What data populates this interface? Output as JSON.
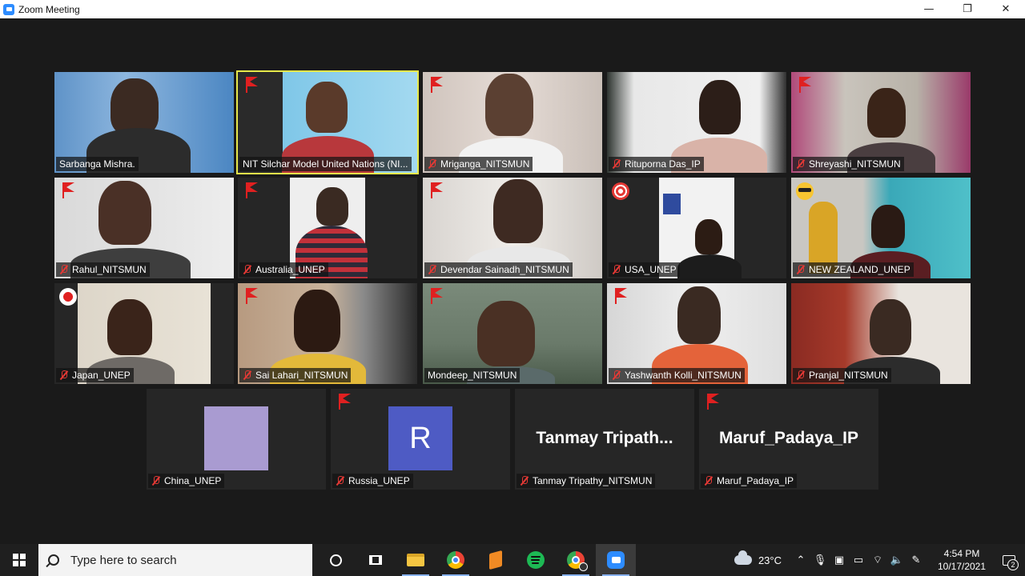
{
  "window": {
    "title": "Zoom Meeting",
    "controls": {
      "minimize": "—",
      "restore": "❐",
      "close": "✕"
    }
  },
  "participants": [
    {
      "name": "Sarbanga Mishra.",
      "muted": false,
      "flag": false,
      "emoji": ""
    },
    {
      "name": "NIT Silchar Model United Nations (NI...",
      "muted": false,
      "flag": true,
      "emoji": ""
    },
    {
      "name": "Mriganga_NITSMUN",
      "muted": true,
      "flag": true,
      "emoji": ""
    },
    {
      "name": "Rituporna Das_IP",
      "muted": true,
      "flag": false,
      "emoji": ""
    },
    {
      "name": "Shreyashi_NITSMUN",
      "muted": true,
      "flag": true,
      "emoji": ""
    },
    {
      "name": "Rahul_NITSMUN",
      "muted": true,
      "flag": true,
      "emoji": ""
    },
    {
      "name": "Australia_UNEP",
      "muted": true,
      "flag": true,
      "emoji": ""
    },
    {
      "name": "Devendar Sainadh_NITSMUN",
      "muted": true,
      "flag": true,
      "emoji": ""
    },
    {
      "name": "USA_UNEP",
      "muted": true,
      "flag": false,
      "emoji": "target"
    },
    {
      "name": "NEW ZEALAND_UNEP",
      "muted": true,
      "flag": false,
      "emoji": "sunglasses"
    },
    {
      "name": "Japan_UNEP",
      "muted": true,
      "flag": false,
      "emoji": "japan-flag"
    },
    {
      "name": "Sai Lahari_NITSMUN",
      "muted": true,
      "flag": true,
      "emoji": ""
    },
    {
      "name": "Mondeep_NITSMUN",
      "muted": false,
      "flag": true,
      "emoji": ""
    },
    {
      "name": "Yashwanth Kolli_NITSMUN",
      "muted": true,
      "flag": true,
      "emoji": ""
    },
    {
      "name": "Pranjal_NITSMUN",
      "muted": true,
      "flag": false,
      "emoji": ""
    },
    {
      "name": "China_UNEP",
      "muted": true,
      "flag": false,
      "emoji": ""
    },
    {
      "name": "Russia_UNEP",
      "muted": true,
      "flag": true,
      "emoji": "",
      "avatar_letter": "R"
    },
    {
      "name": "Tanmay Tripathy_NITSMUN",
      "muted": true,
      "flag": false,
      "emoji": "",
      "display_name": "Tanmay  Tripath..."
    },
    {
      "name": "Maruf_Padaya_IP",
      "muted": true,
      "flag": true,
      "emoji": "",
      "display_name": "Maruf_Padaya_IP"
    }
  ],
  "taskbar": {
    "search_placeholder": "Type here to search",
    "apps": [
      "task-view",
      "file-explorer",
      "chrome",
      "sublime-text",
      "spotify",
      "chrome-profile",
      "zoom"
    ],
    "temperature": "23°C",
    "time": "4:54 PM",
    "date": "10/17/2021",
    "notifications": "2"
  },
  "colors": {
    "active_speaker": "#e6e94a",
    "flag": "#e02020",
    "muted": "#e53935",
    "russia_avatar": "#4e5bc4",
    "china_avatar": "#a99bd1"
  }
}
